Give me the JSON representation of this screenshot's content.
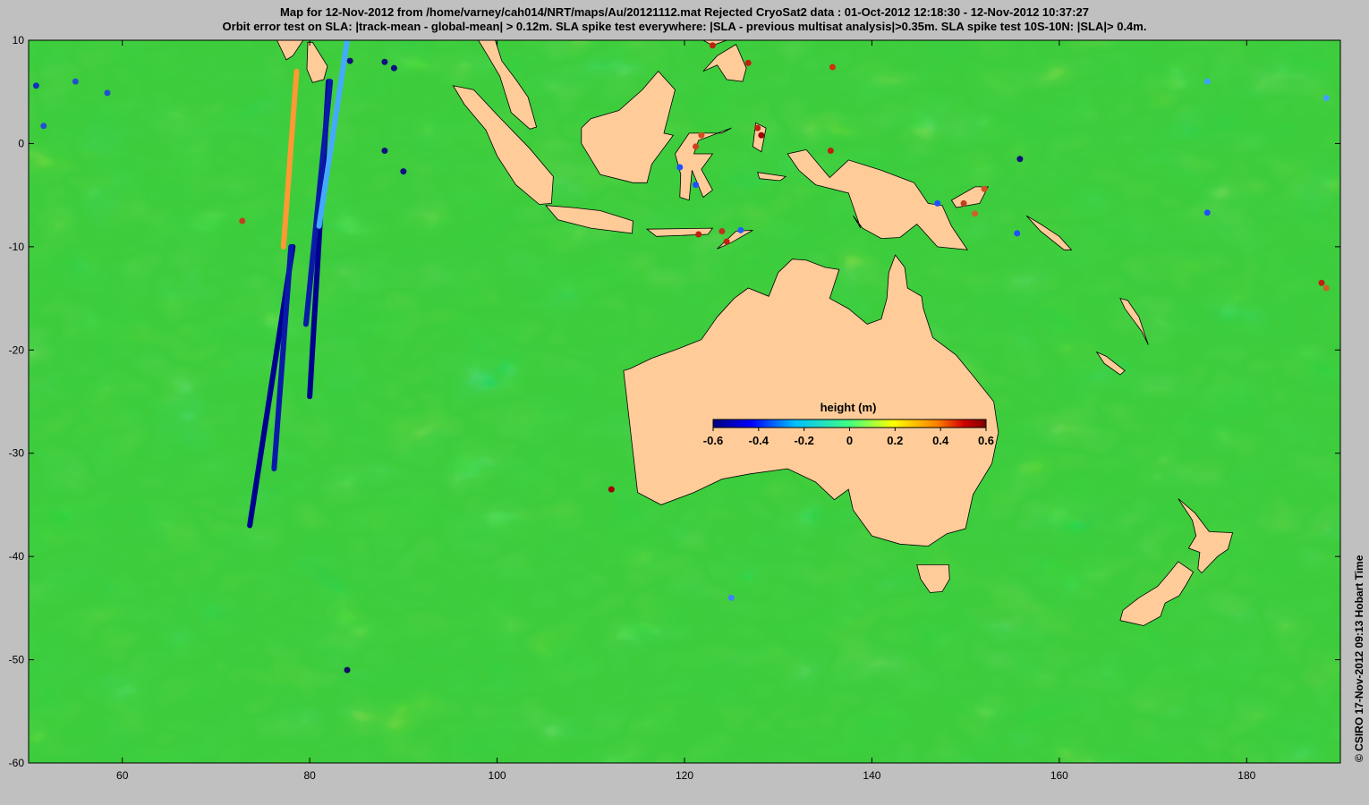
{
  "title": {
    "line1": "Map for 12-Nov-2012 from /home/varney/cah014/NRT/maps/Au/20121112.mat  Rejected CryoSat2 data : 01-Oct-2012 12:18:30 - 12-Nov-2012 10:37:27",
    "line2": "Orbit error test on SLA: |track-mean  - global-mean| > 0.12m.  SLA spike test everywhere: |SLA - previous multisat analysis|>0.35m. SLA spike test 10S-10N: |SLA|> 0.4m."
  },
  "credit": "© CSIRO 17-Nov-2012 09:13 Hobart Time",
  "map": {
    "x_range": [
      50,
      190
    ],
    "y_range": [
      -60,
      10
    ],
    "x_ticks": [
      60,
      80,
      100,
      120,
      140,
      160,
      180
    ],
    "y_ticks": [
      10,
      0,
      -10,
      -20,
      -30,
      -40,
      -50,
      -60
    ],
    "ocean_color": "#3ccc3c",
    "land_color": "#ffcc99"
  },
  "colorbar": {
    "label": "height (m)",
    "ticks": [
      "-0.6",
      "-0.4",
      "-0.2",
      "0",
      "0.2",
      "0.4",
      "0.6"
    ],
    "colors": [
      "#00007f",
      "#0000ff",
      "#00bfff",
      "#40ff80",
      "#ffff00",
      "#ff8000",
      "#bf0000",
      "#7f0000"
    ]
  },
  "tracks": [
    {
      "start": [
        73.6,
        -37
      ],
      "end": [
        78.2,
        -10
      ],
      "color": "#00008f"
    },
    {
      "start": [
        77.2,
        -10
      ],
      "end": [
        78.6,
        7
      ],
      "color": "#ff9933"
    },
    {
      "start": [
        76.2,
        -31.5
      ],
      "end": [
        78.0,
        -10
      ],
      "color": "#0a1aa8"
    },
    {
      "start": [
        80.0,
        -24.5
      ],
      "end": [
        82.0,
        6
      ],
      "color": "#00008f"
    },
    {
      "start": [
        79.6,
        -17.5
      ],
      "end": [
        82.2,
        6
      ],
      "color": "#0a1aa8"
    },
    {
      "start": [
        81.0,
        -8
      ],
      "end": [
        84.0,
        10
      ],
      "color": "#44aaff"
    }
  ],
  "points": [
    {
      "lon": 50.8,
      "lat": 5.6,
      "color": "#1030c0"
    },
    {
      "lon": 51.6,
      "lat": 1.7,
      "color": "#2050d0"
    },
    {
      "lon": 55.0,
      "lat": 6.0,
      "color": "#2050d0"
    },
    {
      "lon": 58.4,
      "lat": 4.9,
      "color": "#2050d0"
    },
    {
      "lon": 72.8,
      "lat": -7.5,
      "color": "#c04020"
    },
    {
      "lon": 84.3,
      "lat": 8.0,
      "color": "#101080"
    },
    {
      "lon": 88.0,
      "lat": 7.9,
      "color": "#101080"
    },
    {
      "lon": 89.0,
      "lat": 7.3,
      "color": "#101080"
    },
    {
      "lon": 88.0,
      "lat": -0.7,
      "color": "#101080"
    },
    {
      "lon": 90.0,
      "lat": -2.7,
      "color": "#101080"
    },
    {
      "lon": 112.2,
      "lat": -33.5,
      "color": "#a00000"
    },
    {
      "lon": 84.0,
      "lat": -51.0,
      "color": "#101060"
    },
    {
      "lon": 123.0,
      "lat": 9.5,
      "color": "#c02010"
    },
    {
      "lon": 126.8,
      "lat": 7.8,
      "color": "#c02010"
    },
    {
      "lon": 127.8,
      "lat": 1.5,
      "color": "#c02010"
    },
    {
      "lon": 128.2,
      "lat": 0.8,
      "color": "#a00000"
    },
    {
      "lon": 121.2,
      "lat": -0.3,
      "color": "#d04020"
    },
    {
      "lon": 121.8,
      "lat": 0.8,
      "color": "#d05020"
    },
    {
      "lon": 119.5,
      "lat": -2.3,
      "color": "#2050ff"
    },
    {
      "lon": 121.2,
      "lat": -4.0,
      "color": "#2050ff"
    },
    {
      "lon": 124.0,
      "lat": -8.5,
      "color": "#c03020"
    },
    {
      "lon": 121.5,
      "lat": -8.8,
      "color": "#c02010"
    },
    {
      "lon": 124.5,
      "lat": -9.5,
      "color": "#c02010"
    },
    {
      "lon": 126.0,
      "lat": -8.4,
      "color": "#2060ff"
    },
    {
      "lon": 135.8,
      "lat": 7.4,
      "color": "#d03010"
    },
    {
      "lon": 135.6,
      "lat": -0.7,
      "color": "#c02010"
    },
    {
      "lon": 149.8,
      "lat": -5.8,
      "color": "#c04020"
    },
    {
      "lon": 147.0,
      "lat": -5.8,
      "color": "#2050ff"
    },
    {
      "lon": 152.0,
      "lat": -4.4,
      "color": "#d05020"
    },
    {
      "lon": 151.0,
      "lat": -6.8,
      "color": "#d06030"
    },
    {
      "lon": 155.5,
      "lat": -8.7,
      "color": "#2050ff"
    },
    {
      "lon": 155.8,
      "lat": -1.5,
      "color": "#101080"
    },
    {
      "lon": 175.8,
      "lat": 6.0,
      "color": "#40a0ff"
    },
    {
      "lon": 175.8,
      "lat": -6.7,
      "color": "#2050ff"
    },
    {
      "lon": 188.0,
      "lat": -13.5,
      "color": "#c02010"
    },
    {
      "lon": 188.5,
      "lat": -14.0,
      "color": "#d06020"
    },
    {
      "lon": 188.5,
      "lat": 4.4,
      "color": "#40a0ff"
    },
    {
      "lon": 125.0,
      "lat": -44.0,
      "color": "#4080ff"
    }
  ]
}
